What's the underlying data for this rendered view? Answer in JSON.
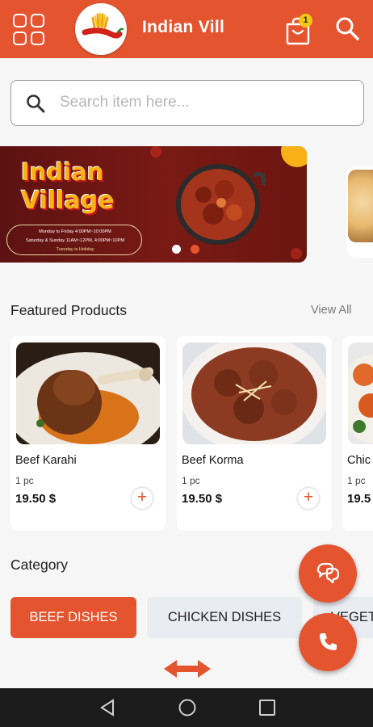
{
  "header": {
    "title": "Indian Vill",
    "cart_count": "1",
    "icons": [
      "grid-menu-icon",
      "chili-logo",
      "cart-icon",
      "search-icon"
    ],
    "accent_color": "#e4552f"
  },
  "search": {
    "placeholder": "Search item here..."
  },
  "banner": {
    "title_line1": "Indian",
    "title_line2": "Village",
    "hours_line1": "Monday to Friday    4:00PM~10:00PM",
    "hours_line2": "Saturday & Sunday    11AM~12PM, 4:00PM~10PM",
    "hours_line3": "Tuesday is Holiday",
    "active_slide": 1,
    "slide_count": 2
  },
  "featured": {
    "title": "Featured Products",
    "view_all": "View All",
    "products": [
      {
        "name": "Beef Karahi",
        "unit": "1 pc",
        "price": "19.50 $"
      },
      {
        "name": "Beef Korma",
        "unit": "1 pc",
        "price": "19.50 $"
      },
      {
        "name": "Chic",
        "unit": "1 pc",
        "price": "19.5"
      }
    ],
    "add_symbol": "+"
  },
  "category": {
    "title": "Category",
    "chips": [
      "BEEF DISHES",
      "CHICKEN DISHES",
      "VEGET"
    ],
    "selected": "BEEF DISHES"
  }
}
